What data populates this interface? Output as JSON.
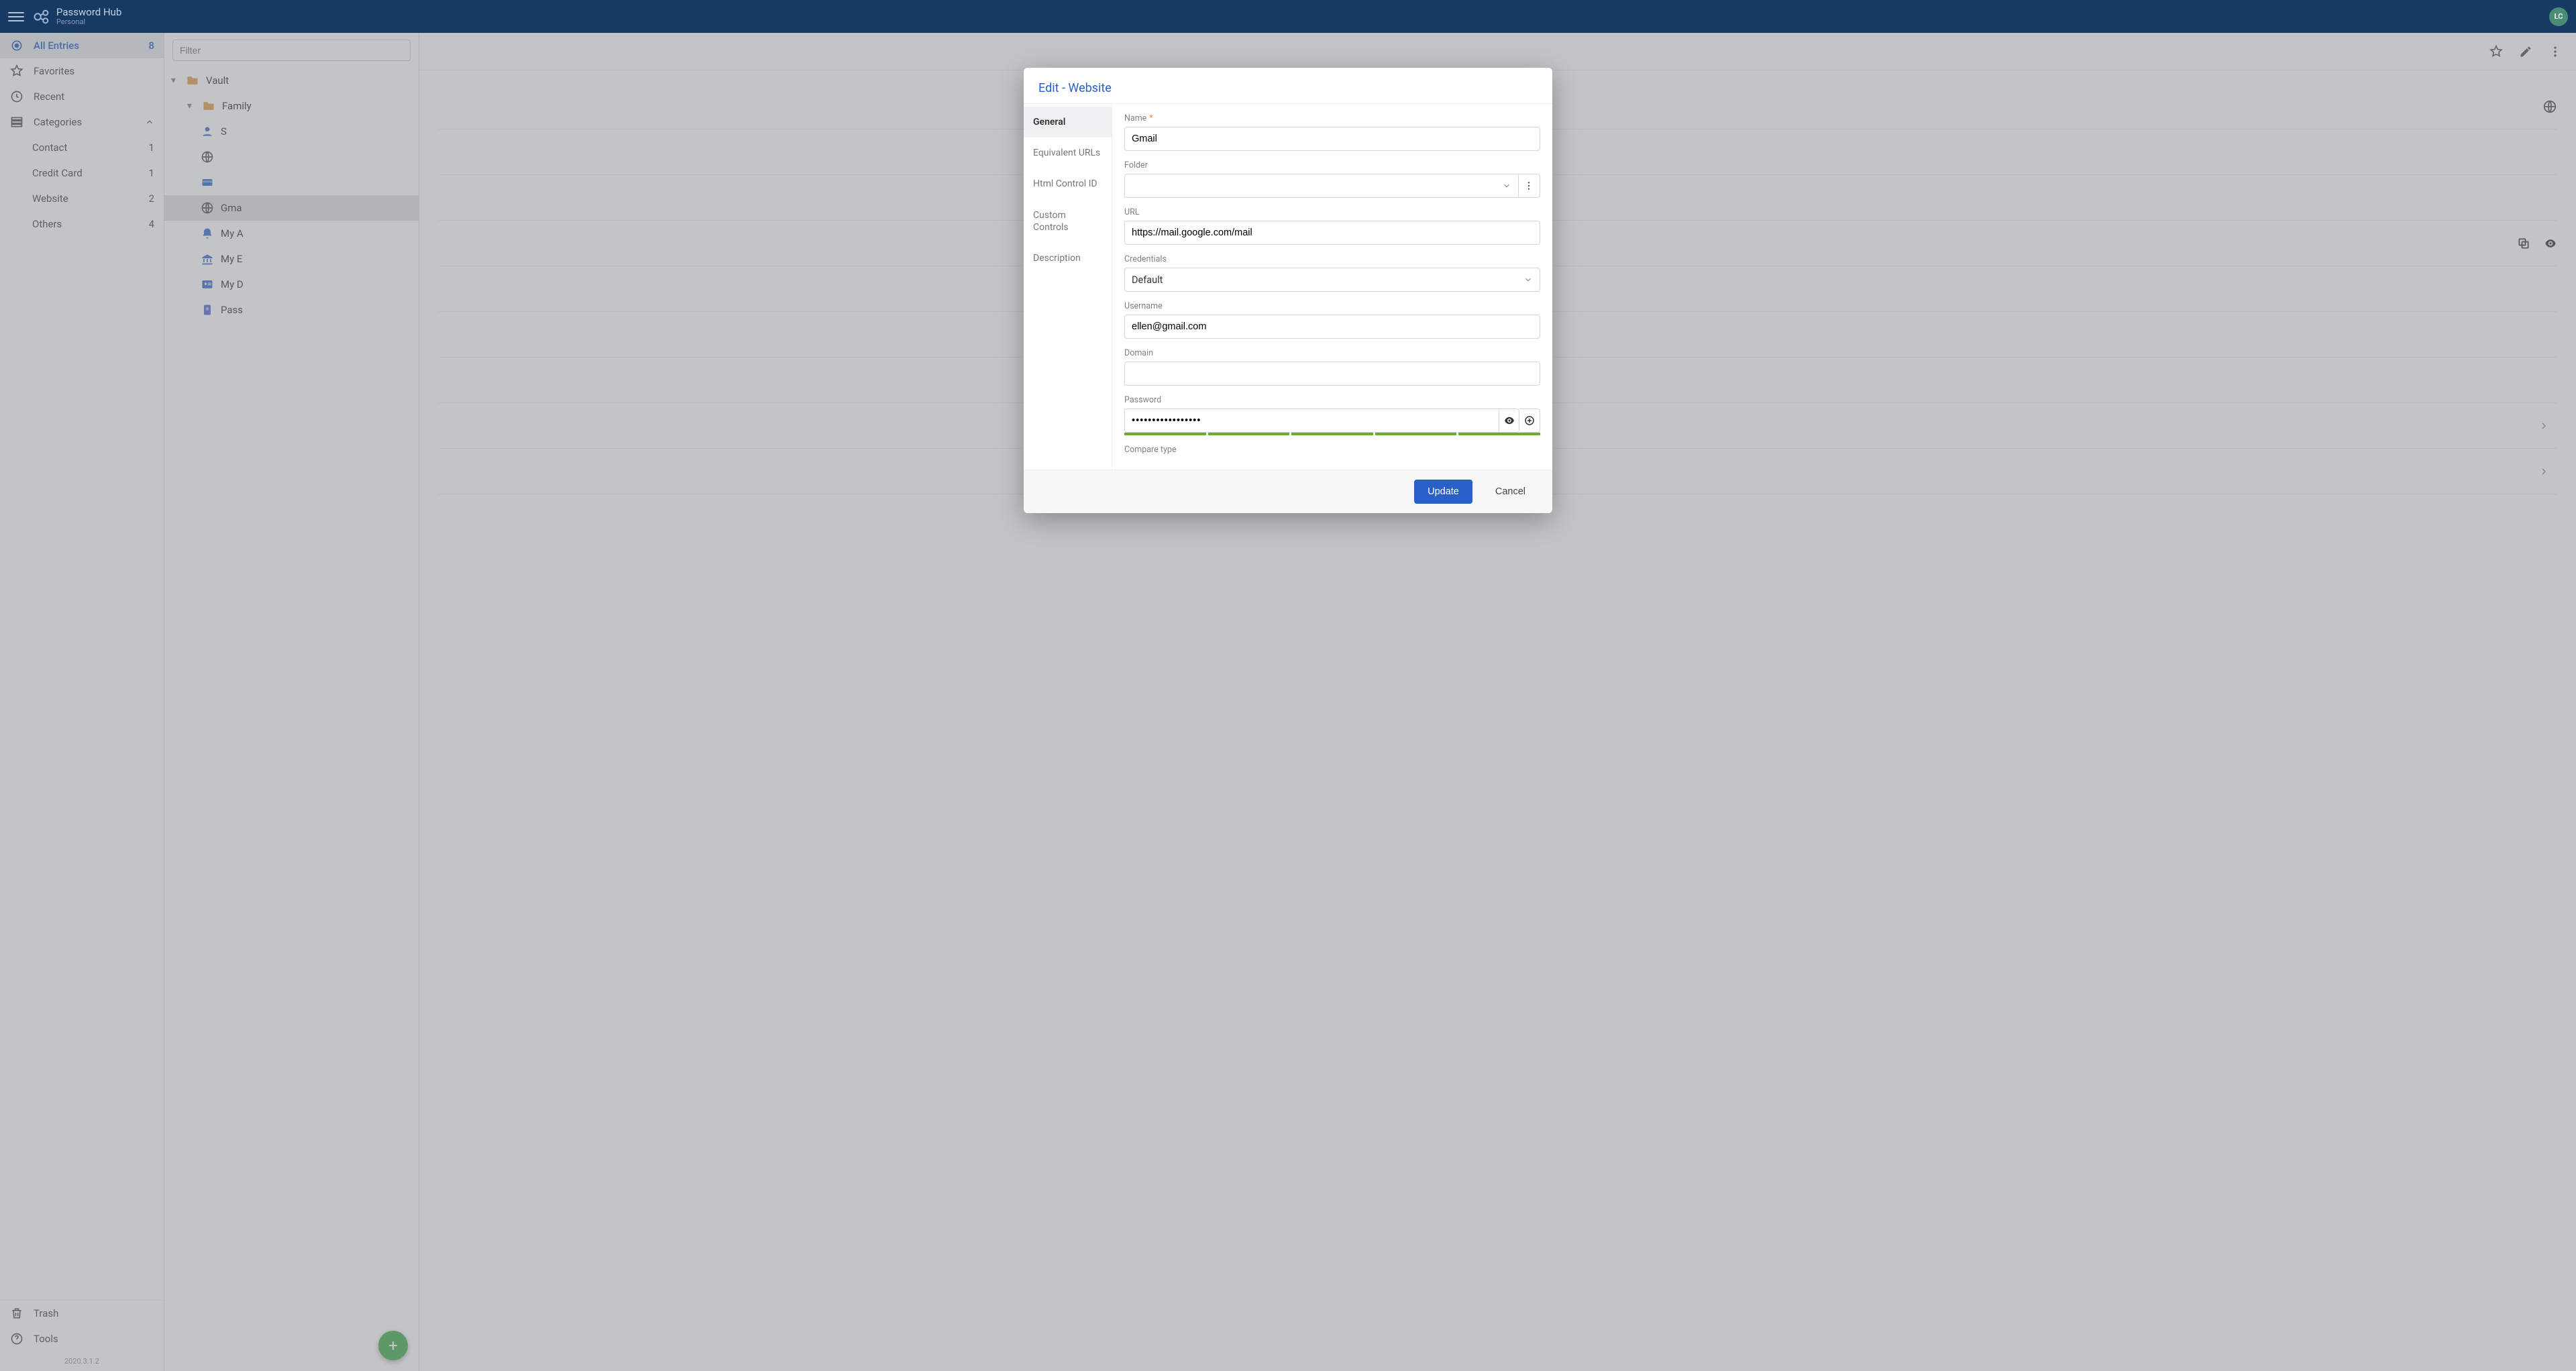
{
  "topbar": {
    "brand_title": "Password Hub",
    "brand_sub": "Personal",
    "avatar_initials": "LC"
  },
  "sidebar": {
    "all_entries": {
      "label": "All Entries",
      "count": "8"
    },
    "favorites": {
      "label": "Favorites"
    },
    "recent": {
      "label": "Recent"
    },
    "categories": {
      "label": "Categories"
    },
    "category_items": [
      {
        "label": "Contact",
        "count": "1"
      },
      {
        "label": "Credit Card",
        "count": "1"
      },
      {
        "label": "Website",
        "count": "2"
      },
      {
        "label": "Others",
        "count": "4"
      }
    ],
    "trash": {
      "label": "Trash"
    },
    "tools": {
      "label": "Tools"
    },
    "version": "2020.3.1.2"
  },
  "list": {
    "filter_placeholder": "Filter",
    "rows": [
      {
        "label": "Vault",
        "level": 0,
        "icon": "folder",
        "caret": true
      },
      {
        "label": "Family",
        "level": 1,
        "icon": "folder",
        "caret": true
      },
      {
        "label": "S",
        "level": 2,
        "icon": "contact"
      },
      {
        "label": "",
        "level": 2,
        "icon": "globe"
      },
      {
        "label": "",
        "level": 2,
        "icon": "card"
      },
      {
        "label": "Gma",
        "level": 2,
        "icon": "globe",
        "selected": true
      },
      {
        "label": "My A",
        "level": 2,
        "icon": "bell"
      },
      {
        "label": "My E",
        "level": 2,
        "icon": "bank"
      },
      {
        "label": "My D",
        "level": 2,
        "icon": "id"
      },
      {
        "label": "Pass",
        "level": 2,
        "icon": "passport"
      }
    ]
  },
  "dialog": {
    "title": "Edit - Website",
    "tabs": [
      "General",
      "Equivalent URLs",
      "Html Control ID",
      "Custom Controls",
      "Description"
    ],
    "fields": {
      "name_label": "Name",
      "name_value": "Gmail",
      "folder_label": "Folder",
      "folder_value": "",
      "url_label": "URL",
      "url_value": "https://mail.google.com/mail",
      "credentials_label": "Credentials",
      "credentials_value": "Default",
      "username_label": "Username",
      "username_value": "ellen@gmail.com",
      "domain_label": "Domain",
      "domain_value": "",
      "password_label": "Password",
      "password_value": "•••••••••••••••••",
      "compare_label": "Compare type"
    },
    "update_label": "Update",
    "cancel_label": "Cancel"
  }
}
